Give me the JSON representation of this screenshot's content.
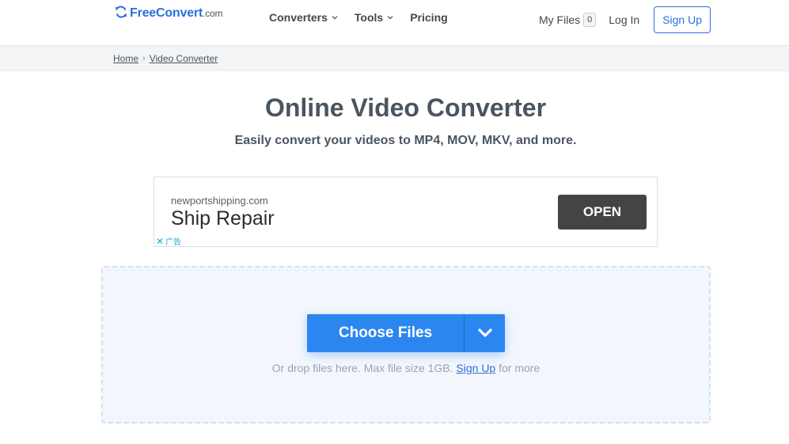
{
  "header": {
    "logo_brand": "FreeConvert",
    "logo_suffix": ".com",
    "nav": [
      {
        "label": "Converters",
        "has_dropdown": true
      },
      {
        "label": "Tools",
        "has_dropdown": true
      },
      {
        "label": "Pricing",
        "has_dropdown": false
      }
    ],
    "my_files_label": "My Files",
    "my_files_count": "0",
    "login_label": "Log In",
    "signup_label": "Sign Up"
  },
  "breadcrumb": {
    "home": "Home",
    "current": "Video Converter"
  },
  "main": {
    "title": "Online Video Converter",
    "subtitle": "Easily convert your videos to MP4, MOV, MKV, and more."
  },
  "ad": {
    "domain": "newportshipping.com",
    "headline": "Ship Repair",
    "cta": "OPEN",
    "close_glyph": "✕",
    "ad_label": "广告"
  },
  "dropzone": {
    "button_label": "Choose Files",
    "hint_before": "Or drop files here. Max file size 1GB.",
    "hint_link": "Sign Up",
    "hint_after": "for more"
  },
  "colors": {
    "accent": "#2c86ef",
    "brand": "#2a6fdb",
    "text": "#4a5560",
    "ad_button": "#444444"
  }
}
